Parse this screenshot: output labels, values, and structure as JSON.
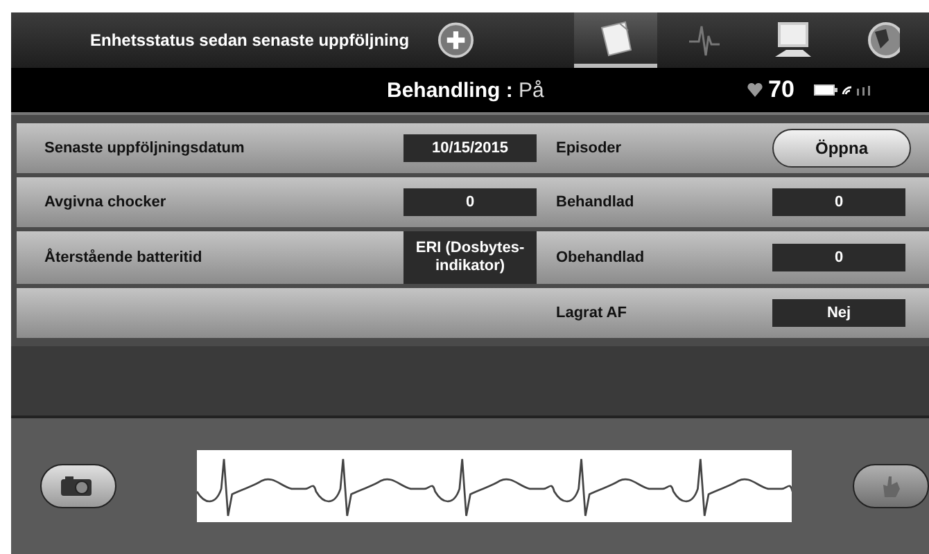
{
  "header": {
    "title": "Enhetsstatus sedan senaste uppföljning",
    "tabs": [
      {
        "kind": "note",
        "selected": true
      },
      {
        "kind": "wave",
        "selected": false
      },
      {
        "kind": "monitor",
        "selected": false
      },
      {
        "kind": "globe",
        "selected": false
      }
    ]
  },
  "status_bar": {
    "label": "Behandling",
    "separator": ":",
    "value": "På",
    "heart_rate": "70"
  },
  "rows": [
    {
      "left": {
        "label": "Senaste uppföljningsdatum",
        "value": "10/15/2015"
      },
      "right": {
        "label": "Episoder",
        "kind": "button",
        "value": "Öppna"
      }
    },
    {
      "left": {
        "label": "Avgivna chocker",
        "value": "0"
      },
      "right": {
        "label": "Behandlad",
        "kind": "value",
        "value": "0"
      }
    },
    {
      "left": {
        "label": "Återstående batteritid",
        "value": "ERI (Dosbytes-indikator)"
      },
      "right": {
        "label": "Obehandlad",
        "kind": "value",
        "value": "0"
      }
    },
    {
      "right": {
        "label": "Lagrat AF",
        "kind": "value",
        "value": "Nej"
      }
    }
  ],
  "footer": {
    "snapshot_button": {
      "disabled": false
    },
    "flag_button": {
      "disabled": true
    }
  }
}
